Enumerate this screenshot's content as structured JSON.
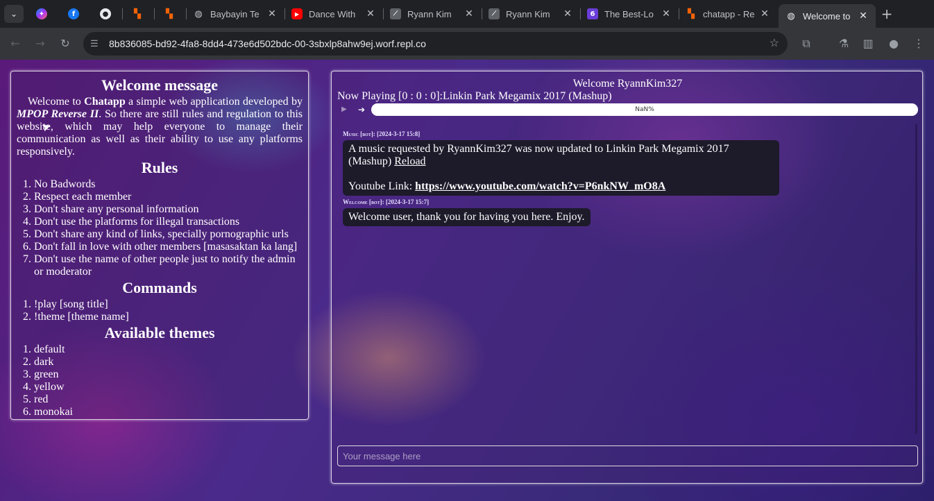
{
  "browser": {
    "tabs": [
      {
        "title": "",
        "icon": "messenger-icon",
        "pinned": true
      },
      {
        "title": "",
        "icon": "facebook-icon",
        "pinned": true
      },
      {
        "title": "",
        "icon": "github-icon",
        "pinned": true
      },
      {
        "title": "",
        "icon": "replit-icon",
        "pinned": true
      },
      {
        "title": "",
        "icon": "replit-icon",
        "pinned": true
      },
      {
        "title": "Baybayin Te",
        "icon": "globe-icon"
      },
      {
        "title": "Dance With",
        "icon": "youtube-icon"
      },
      {
        "title": "Ryann Kim",
        "icon": "chart-icon"
      },
      {
        "title": "Ryann Kim",
        "icon": "chart-icon"
      },
      {
        "title": "The Best-Lo",
        "icon": "six-icon"
      },
      {
        "title": "chatapp - Re",
        "icon": "replit-icon"
      },
      {
        "title": "Welcome to",
        "icon": "globe-icon",
        "active": true
      }
    ],
    "url": "8b836085-bd92-4fa8-8dd4-473e6d502bdc-00-3sbxlp8ahw9ej.worf.repl.co",
    "new_tab": "+",
    "tab_list": "⌄"
  },
  "left_panel": {
    "welcome_title": "Welcome message",
    "welcome_text_1": "Welcome to ",
    "app_name": "Chatapp",
    "welcome_text_2": " a simple web application developed by ",
    "developer": "MPOP Reverse II",
    "welcome_text_3": ". So there are still rules and regulation to this website, which may help everyone to manage their communication as well as their ability to use any platforms responsively.",
    "rules_title": "Rules",
    "rules": [
      "No Badwords",
      "Respect each member",
      "Don't share any personal information",
      "Don't use the platforms for illegal transactions",
      "Don't share any kind of links, specially pornographic urls",
      "Don't fall in love with other members [masasaktan ka lang]",
      "Don't use the name of other people just to notify the admin or moderator"
    ],
    "commands_title": "Commands",
    "commands": [
      "!play [song title]",
      "!theme [theme name]"
    ],
    "themes_title": "Available themes",
    "themes": [
      "default",
      "dark",
      "green",
      "yellow",
      "red",
      "monokai"
    ]
  },
  "right_panel": {
    "welcome_user": "Welcome RyannKim327",
    "now_playing": "Now Playing [0 : 0 : 0]:Linkin Park Megamix 2017 (Mashup)",
    "progress_text": "NaN%",
    "progress_value": 0,
    "messages": [
      {
        "header": "Music [bot]: [2024-3-17 15:8]",
        "text": "A music requested by RyannKim327 was now updated to Linkin Park Megamix 2017 (Mashup) ",
        "reload_label": "Reload",
        "link_label": "Youtube Link: ",
        "link": "https://www.youtube.com/watch?v=P6nkNW_mO8A"
      },
      {
        "header": "Welcome [bot]: [2024-3-17 15:7]",
        "text": "Welcome user, thank you for having you here. Enjoy."
      }
    ],
    "input_placeholder": "Your message here"
  }
}
